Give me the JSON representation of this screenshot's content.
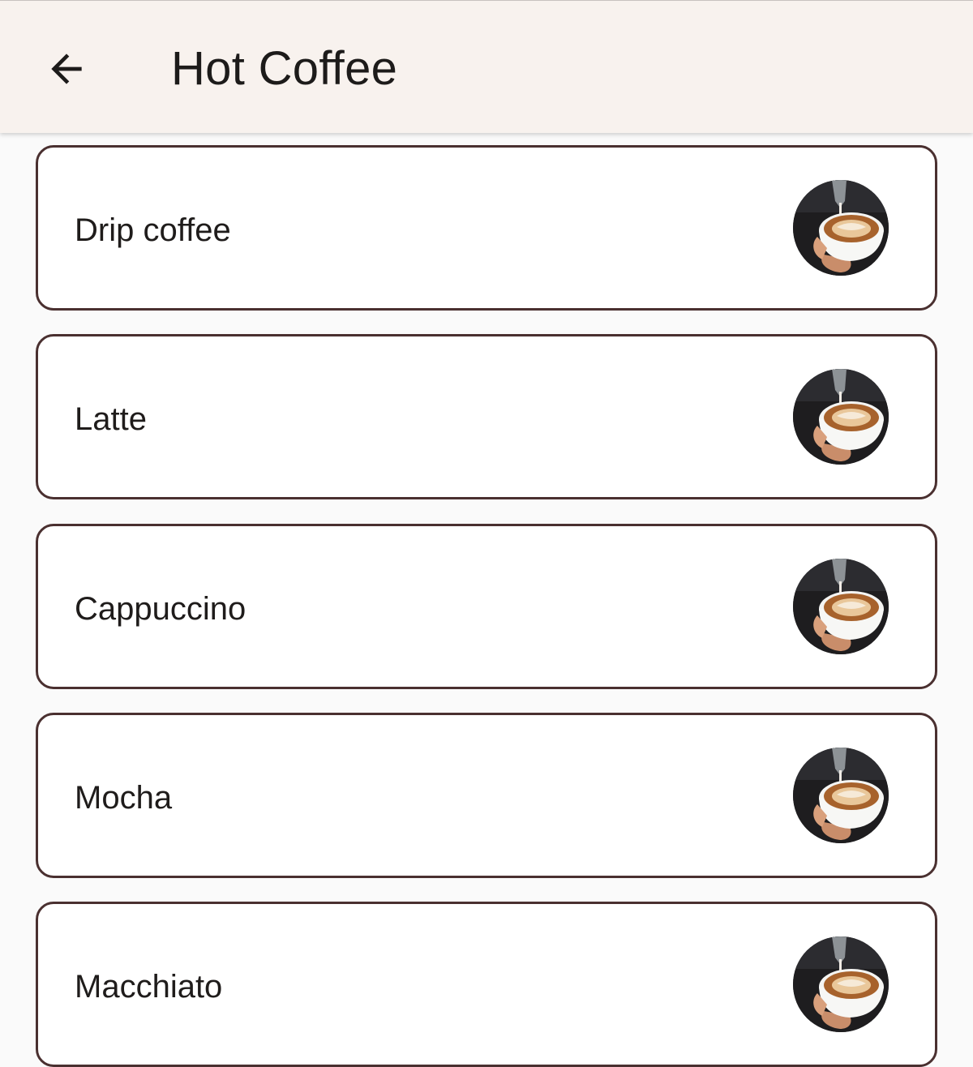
{
  "app_bar": {
    "back_icon": "arrow-left-icon",
    "title": "Hot Coffee"
  },
  "items": [
    {
      "label": "Drip coffee",
      "thumbnail_icon": "latte-art-image"
    },
    {
      "label": "Latte",
      "thumbnail_icon": "latte-art-image"
    },
    {
      "label": "Cappuccino",
      "thumbnail_icon": "latte-art-image"
    },
    {
      "label": "Mocha",
      "thumbnail_icon": "latte-art-image"
    },
    {
      "label": "Macchiato",
      "thumbnail_icon": "latte-art-image"
    }
  ],
  "colors": {
    "app_bar_bg": "#f8f2ee",
    "card_border": "#4a3030",
    "page_bg": "#fafafa"
  }
}
